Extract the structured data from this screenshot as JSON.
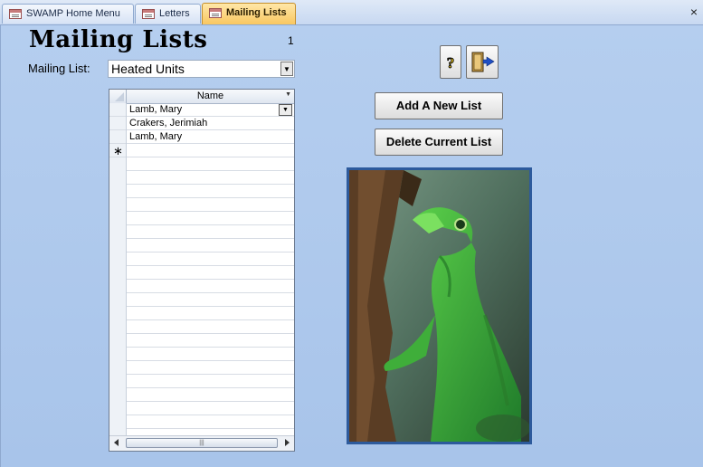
{
  "tabs": [
    {
      "label": "SWAMP Home Menu",
      "active": false
    },
    {
      "label": "Letters",
      "active": false
    },
    {
      "label": "Mailing Lists",
      "active": true
    }
  ],
  "close_symbol": "×",
  "form": {
    "title": "Mailing Lists",
    "record_count": "1",
    "mailing_list_label": "Mailing List:",
    "mailing_list_value": "Heated Units"
  },
  "grid": {
    "column_header": "Name",
    "rows": [
      "Lamb, Mary",
      "Crakers, Jerimiah",
      "Lamb, Mary"
    ],
    "new_row_marker": "∗"
  },
  "buttons": {
    "help_icon": "help-icon",
    "exit_icon": "exit-door-icon",
    "add_list": "Add A New List",
    "delete_list": "Delete Current List"
  },
  "image": {
    "subject": "green-lizard-photo"
  },
  "colors": {
    "active_tab": "#f9c760",
    "form_background": "#b5ceef",
    "photo_border": "#2d5a9c"
  }
}
